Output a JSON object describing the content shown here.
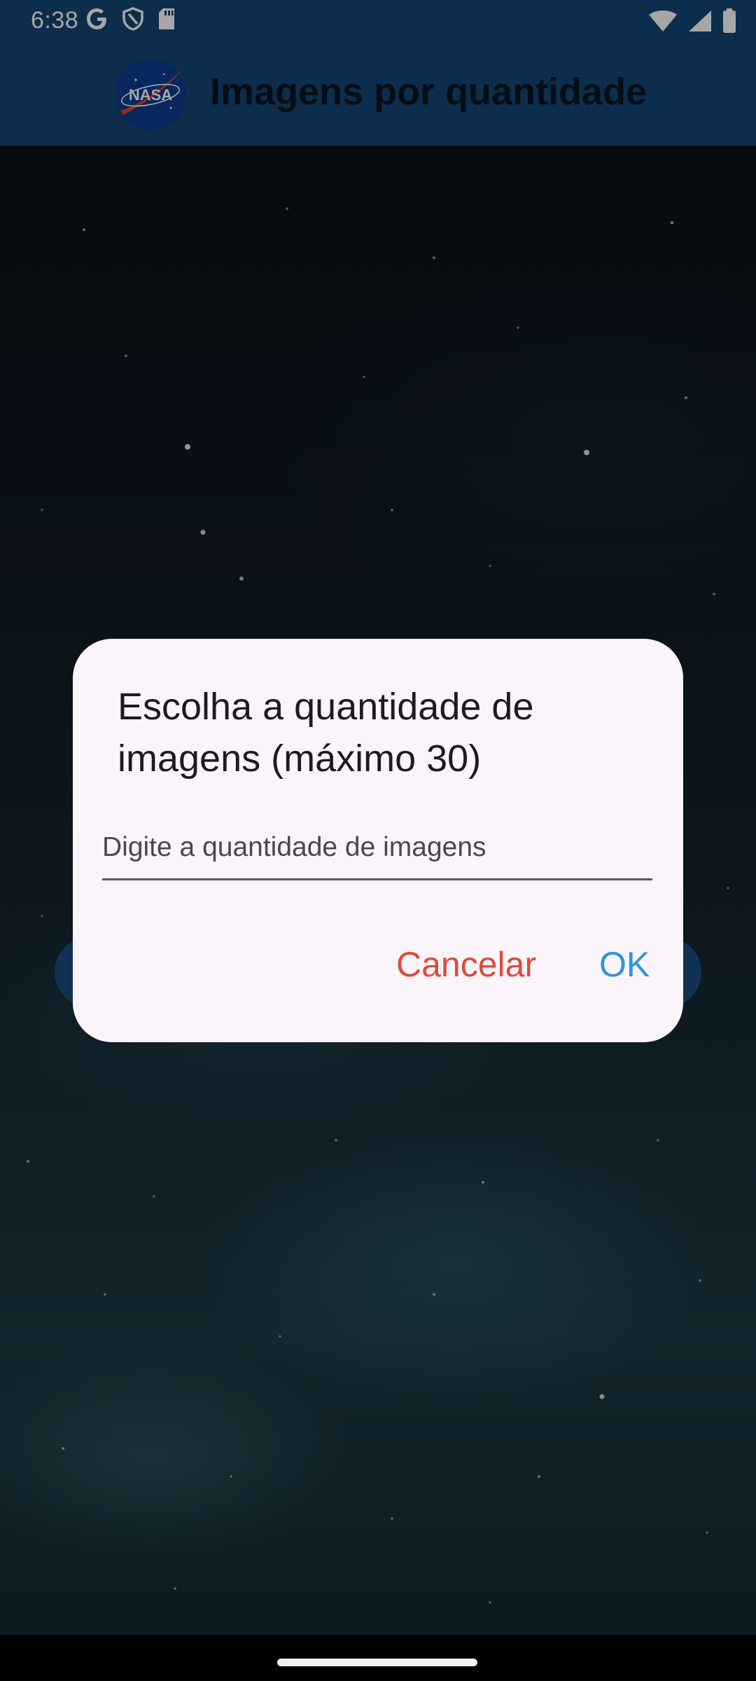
{
  "status_bar": {
    "time": "6:38",
    "icons_left": [
      "google-icon",
      "shield-icon",
      "sd-card-icon"
    ],
    "icons_right": [
      "wifi-icon",
      "signal-icon",
      "battery-icon"
    ]
  },
  "app_bar": {
    "logo_text": "NASA",
    "title": "Imagens por quantidade"
  },
  "dialog": {
    "title": "Escolha a quantidade de imagens (máximo 30)",
    "input_placeholder": "Digite a quantidade de imagens",
    "input_value": "",
    "cancel_label": "Cancelar",
    "ok_label": "OK"
  },
  "colors": {
    "app_bar": "#134674",
    "dialog_background": "#fcf4fb",
    "cancel": "#e04a3a",
    "ok": "#2d95e0"
  }
}
